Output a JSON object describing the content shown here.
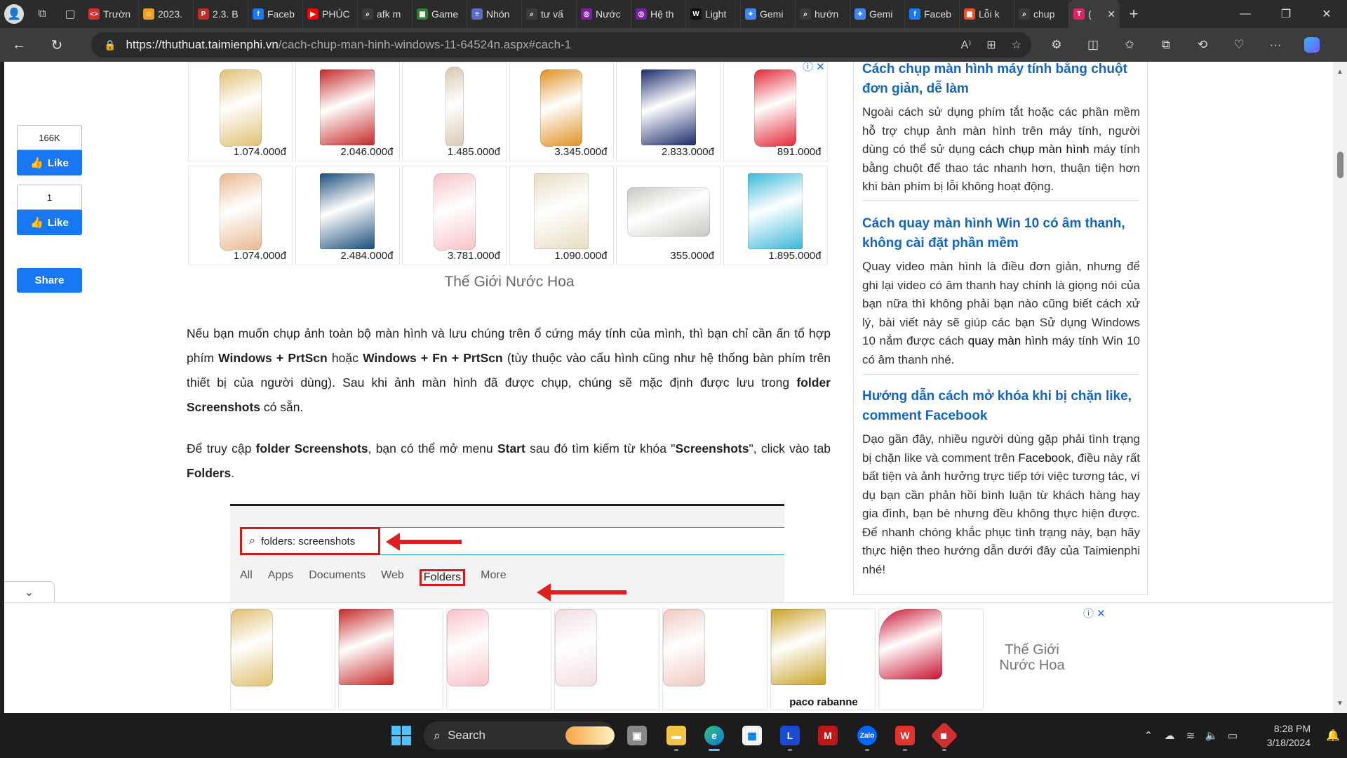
{
  "browser": {
    "tabs": [
      {
        "title": "Trườn",
        "color": "#d62d2d",
        "glyph": "<>"
      },
      {
        "title": "2023.",
        "color": "#f0a020",
        "glyph": "☺"
      },
      {
        "title": "2.3. B",
        "color": "#c62828",
        "glyph": "P"
      },
      {
        "title": "Faceb",
        "color": "#1877f2",
        "glyph": "f"
      },
      {
        "title": "PHÚC",
        "color": "#ff0000",
        "glyph": "▶"
      },
      {
        "title": "afk m",
        "color": "#3c3c3c",
        "glyph": "⌕"
      },
      {
        "title": "Game",
        "color": "#2e7d32",
        "glyph": "▦"
      },
      {
        "title": "Nhón",
        "color": "#5c6bc0",
        "glyph": "≡"
      },
      {
        "title": "tư vấ",
        "color": "#3c3c3c",
        "glyph": "⌕"
      },
      {
        "title": "Nước",
        "color": "#7b1fa2",
        "glyph": "◎"
      },
      {
        "title": "Hệ th",
        "color": "#7b1fa2",
        "glyph": "◎"
      },
      {
        "title": "Light",
        "color": "#111111",
        "glyph": "W"
      },
      {
        "title": "Gemi",
        "color": "#4285f4",
        "glyph": "✦"
      },
      {
        "title": "hướn",
        "color": "#3c3c3c",
        "glyph": "⌕"
      },
      {
        "title": "Gemi",
        "color": "#4285f4",
        "glyph": "✦"
      },
      {
        "title": "Faceb",
        "color": "#1877f2",
        "glyph": "f"
      },
      {
        "title": "Lỗi k",
        "color": "#f25022",
        "glyph": "▦"
      },
      {
        "title": "chup",
        "color": "#3c3c3c",
        "glyph": "⌕"
      }
    ],
    "active_tab": {
      "title": "(",
      "color": "#e91e63",
      "glyph": "T"
    },
    "url_host": "https://thuthuat.taimienphi.vn",
    "url_path": "/cach-chup-man-hinh-windows-11-64524n.aspx#cach-1"
  },
  "social": {
    "like1_count": "166K",
    "like1_label": "Like",
    "like2_count": "1",
    "like2_label": "Like",
    "share_label": "Share"
  },
  "ad_grid": {
    "products": [
      {
        "price": "1.074.000đ",
        "color": "#e0c070",
        "kind": "bottle-gold"
      },
      {
        "price": "2.046.000đ",
        "color": "#c62828",
        "kind": "box-red"
      },
      {
        "price": "1.485.000đ",
        "color": "#d8c6b0",
        "kind": "tube"
      },
      {
        "price": "3.345.000đ",
        "color": "#e09020",
        "kind": "bottle-amber"
      },
      {
        "price": "2.833.000đ",
        "color": "#1a2a6a",
        "kind": "box-navy"
      },
      {
        "price": "891.000đ",
        "color": "#e32636",
        "kind": "bottle-red"
      },
      {
        "price": "1.074.000đ",
        "color": "#e8b890",
        "kind": "bottle-peach"
      },
      {
        "price": "2.484.000đ",
        "color": "#1a4d7a",
        "kind": "box-blue"
      },
      {
        "price": "3.781.000đ",
        "color": "#f7c1c8",
        "kind": "bottle-pink"
      },
      {
        "price": "1.090.000đ",
        "color": "#e8dcc0",
        "kind": "box-cream"
      },
      {
        "price": "355.000đ",
        "color": "#c8c8c0",
        "kind": "tin"
      },
      {
        "price": "1.895.000đ",
        "color": "#39b8d8",
        "kind": "box-cyan"
      }
    ],
    "caption": "Thế Giới Nước Hoa"
  },
  "article": {
    "p1_a": "Nếu bạn muốn chụp ảnh toàn bộ màn hình và lưu chúng trên ổ cứng máy tính của mình, thì bạn chỉ cần ấn tổ hợp phím ",
    "p1_b1": "Windows + PrtScn",
    "p1_c": " hoặc ",
    "p1_b2": "Windows + Fn + PrtScn",
    "p1_d": " (tùy thuộc vào cấu hình cũng như hệ thống bàn phím trên thiết bị của người dùng). Sau khi ảnh màn hình đã được chụp, chúng sẽ mặc định được lưu trong ",
    "p1_b3": "folder Screenshots",
    "p1_e": " có sẵn.",
    "p2_a": "Để truy cập ",
    "p2_b1": "folder Screenshots",
    "p2_c": ", bạn có thể mở menu ",
    "p2_b2": "Start",
    "p2_d": " sau đó tìm kiếm từ khóa \"",
    "p2_b3": "Screenshots",
    "p2_e": "\", click vào tab ",
    "p2_b4": "Folders",
    "p2_f": "."
  },
  "inset": {
    "search_text": "folders: screenshots",
    "tabs": [
      "All",
      "Apps",
      "Documents",
      "Web",
      "Folders",
      "More"
    ],
    "selected_tab": "Folders"
  },
  "sidebar": {
    "items": [
      {
        "title": "Cách chụp màn hình máy tính bằng chuột đơn giản, dễ làm",
        "desc_a": "Ngoài cách sử dụng phím tắt hoặc các phần mềm hỗ trợ chụp ảnh màn hình trên máy tính, người dùng có thể sử dụng ",
        "desc_b": "cách chụp màn hình",
        "desc_c": " máy tính bằng chuột để thao tác nhanh hơn, thuận tiện hơn khi bàn phím bị lỗi không hoạt động."
      },
      {
        "title": "Cách quay màn hình Win 10 có âm thanh, không cài đặt phần mềm",
        "desc_a": "Quay video màn hình là điều đơn giản, nhưng để ghi lại video có âm thanh hay chính là giọng nói của bạn nữa thì không phải bạn nào cũng biết cách xử lý, bài viết này sẽ giúp các bạn Sử dụng Windows 10 nắm được cách ",
        "desc_b": "quay màn hình",
        "desc_c": " máy tính Win 10 có âm thanh nhé."
      },
      {
        "title": "Hướng dẫn cách mở khóa khi bị chặn like, comment Facebook",
        "desc_a": "Dạo gần đây, nhiều người dùng gặp phải tình trạng bị chặn like và comment trên ",
        "desc_b": "Facebook",
        "desc_c": ", điều này rất bất tiện và ảnh hưởng trực tiếp tới việc tương tác, ví dụ bạn cần phản hồi bình luận từ khách hàng hay gia đình, bạn bè nhưng đều không thực hiện được. Để nhanh chóng khắc phục tình trạng này, bạn hãy thực hiện theo hướng dẫn dưới đây của Taimienphi nhé!"
      }
    ]
  },
  "bottom_ad": {
    "products": [
      {
        "color": "#e0c070",
        "kind": "bottle-gold"
      },
      {
        "color": "#c62828",
        "kind": "box-red"
      },
      {
        "color": "#f7c1c8",
        "kind": "bottle-pink"
      },
      {
        "color": "#f3dde0",
        "kind": "bottle-blush"
      },
      {
        "color": "#f0c8c0",
        "kind": "bottle-rose"
      },
      {
        "color": "#c9a227",
        "kind": "box-gold"
      },
      {
        "color": "#c8102e",
        "kind": "shoe-red"
      }
    ],
    "brand": "Thế Giới Nước Hoa",
    "logo_text": "paco rabanne"
  },
  "taskbar": {
    "search_label": "Search",
    "time": "8:28 PM",
    "date": "3/18/2024"
  }
}
